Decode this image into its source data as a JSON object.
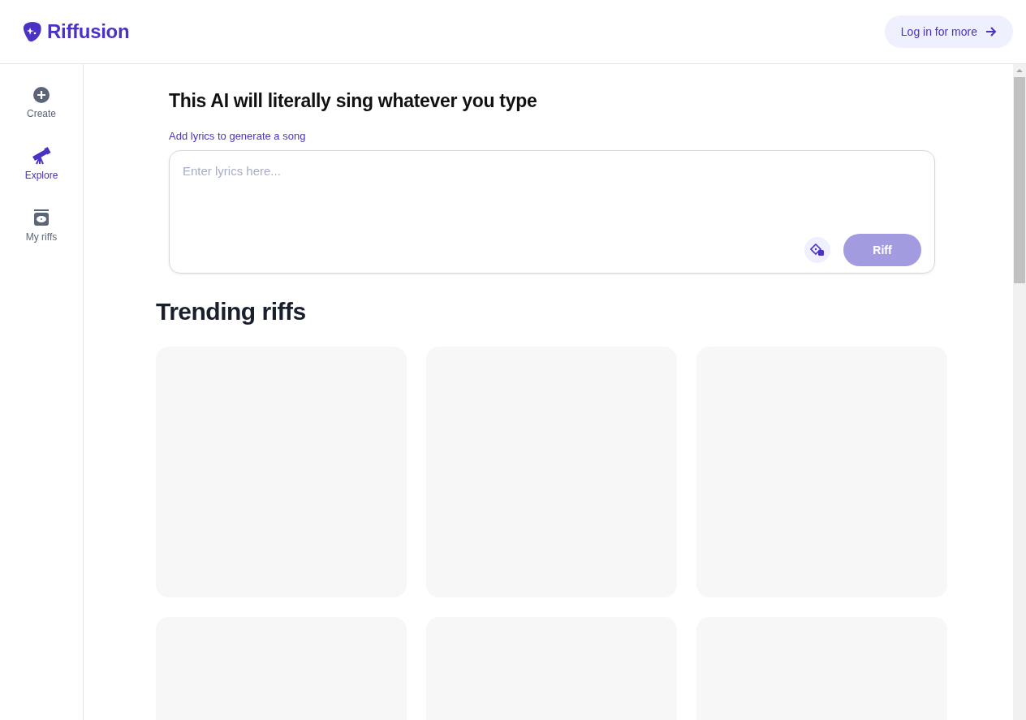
{
  "header": {
    "logo": "Riffusion",
    "login_button": "Log in for more"
  },
  "sidebar": {
    "items": [
      {
        "label": "Create",
        "kind": "create",
        "selected": false
      },
      {
        "label": "Explore",
        "kind": "explore",
        "selected": true
      },
      {
        "label": "My riffs",
        "kind": "library",
        "selected": false
      }
    ]
  },
  "composer": {
    "title": "This AI will literally sing whatever you type",
    "subtitle": "Add lyrics to generate a song",
    "placeholder": "Enter lyrics here...",
    "submit_button": "Riff",
    "submit_disabled": true
  },
  "trending": {
    "title": "Trending riffs",
    "cards": [
      {
        "kind": "loading"
      },
      {
        "kind": "loading"
      },
      {
        "kind": "loading"
      },
      {
        "kind": "loading"
      },
      {
        "kind": "loading"
      },
      {
        "kind": "loading"
      }
    ]
  }
}
